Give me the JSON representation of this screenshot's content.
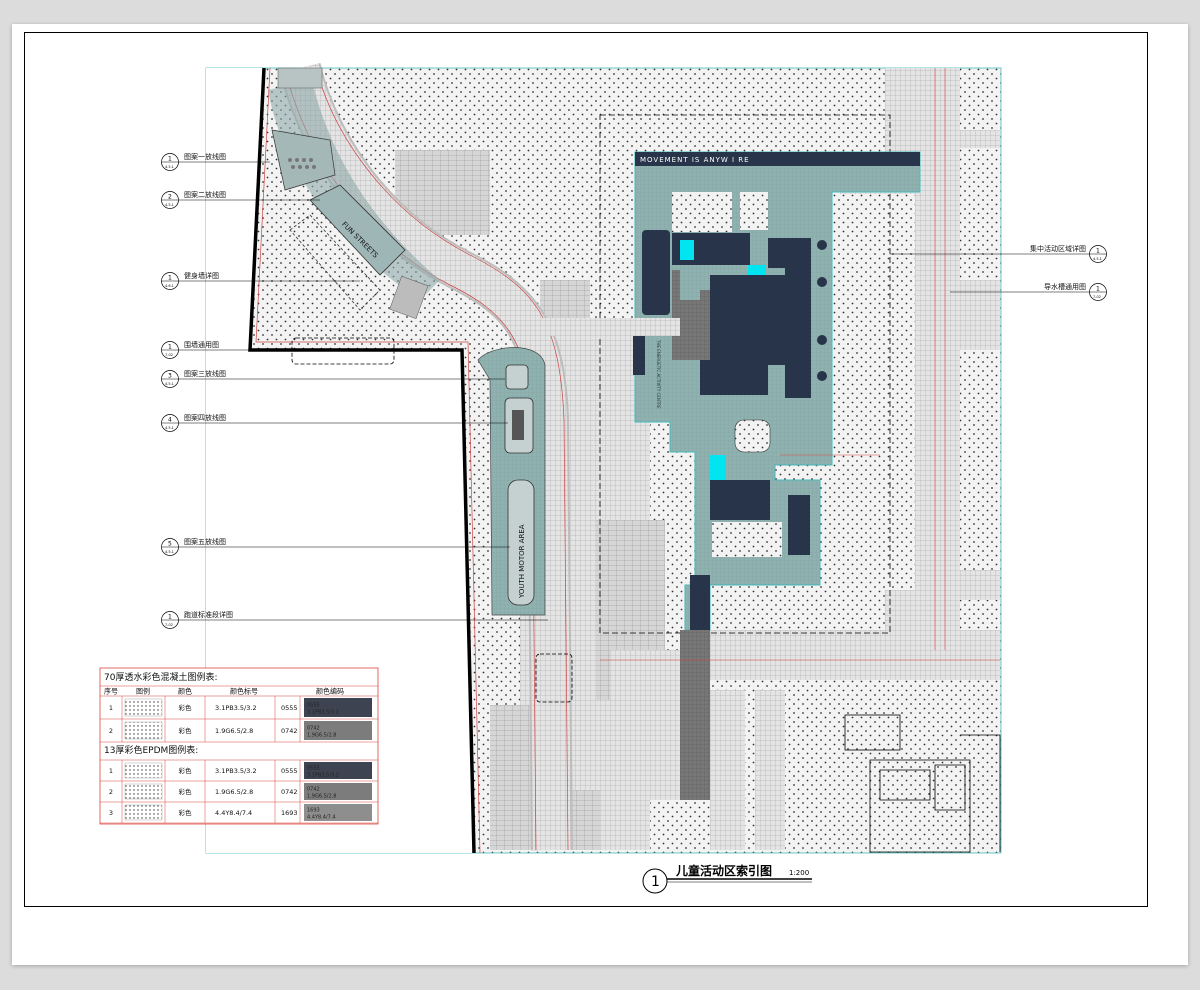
{
  "callouts": [
    {
      "num": "1",
      "ref": "4.5.1",
      "text": "图案一放线图"
    },
    {
      "num": "2",
      "ref": "4.5.1",
      "text": "图案二放线图"
    },
    {
      "num": "1",
      "ref": "4.6.1",
      "text": "健身墙详图"
    },
    {
      "num": "1",
      "ref": "7-02",
      "text": "围墙通用图"
    },
    {
      "num": "3",
      "ref": "4.5.1",
      "text": "图案三放线图"
    },
    {
      "num": "4",
      "ref": "4.5.1",
      "text": "图案四放线图"
    },
    {
      "num": "5",
      "ref": "4.5.1",
      "text": "图案五放线图"
    },
    {
      "num": "1",
      "ref": "7-02",
      "text": "跑道标准段详图"
    },
    {
      "num": "1",
      "ref": "4.5.1",
      "text": "集中活动区域详图"
    },
    {
      "num": "1",
      "ref": "7-02",
      "text": "导水槽通用图"
    }
  ],
  "plan_text": {
    "banner": "MOVEMENT IS ANYW  I RE",
    "area1": "FUN STREETS",
    "area2": "YOUTH MOTOR AREA",
    "vertical": "THE ENERGETIC ACTIVITY CENTRE"
  },
  "title": {
    "num": "1",
    "text": "儿童活动区索引图",
    "scale": "1:200"
  },
  "legend": {
    "title1": "70厚透水彩色混凝土图例表:",
    "title2": "13厚彩色EPDM图例表:",
    "headers": [
      "序号",
      "图例",
      "颜色",
      "颜色标号",
      "颜色编码"
    ],
    "rows1": [
      {
        "no": "1",
        "color": "彩色",
        "code": "3.1PB3.5/3.2",
        "num": "0555",
        "swatch_a": "0555",
        "swatch_b": "3.1PB3.5/3.2",
        "fill": "#3d4350"
      },
      {
        "no": "2",
        "color": "彩色",
        "code": "1.9G6.5/2.8",
        "num": "0742",
        "swatch_a": "0742",
        "swatch_b": "1.9G6.5/2.8",
        "fill": "#7c7c7c"
      }
    ],
    "rows2": [
      {
        "no": "1",
        "color": "彩色",
        "code": "3.1PB3.5/3.2",
        "num": "0555",
        "swatch_a": "0555",
        "swatch_b": "3.1PB3.5/3.2",
        "fill": "#3d4350"
      },
      {
        "no": "2",
        "color": "彩色",
        "code": "1.9G6.5/2.8",
        "num": "0742",
        "swatch_a": "0742",
        "swatch_b": "1.9G6.5/2.8",
        "fill": "#7c7c7c"
      },
      {
        "no": "3",
        "color": "彩色",
        "code": "4.4Y8.4/7.4",
        "num": "1693",
        "swatch_a": "1693",
        "swatch_b": "4.4Y8.4/7.4",
        "fill": "#8e8e8e"
      }
    ]
  },
  "colors": {
    "teal": "#8fb2b1",
    "navy": "#27344a",
    "cyan": "#00e5f0",
    "dot_bg": "#f1f1f1",
    "red": "#d9463e"
  }
}
